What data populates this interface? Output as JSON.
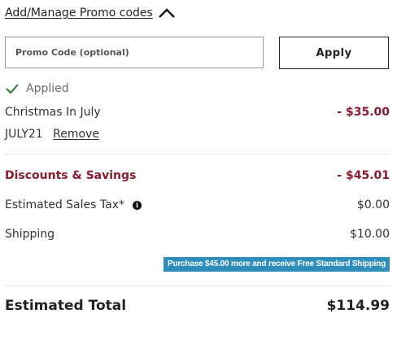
{
  "promo": {
    "toggle_label": "Add/Manage Promo codes",
    "input_placeholder": "Promo Code (optional)",
    "input_value": "",
    "apply_label": "Apply",
    "applied_label": "Applied",
    "applied_promo_name": "Christmas In July",
    "applied_promo_amount": "- $35.00",
    "applied_code": "JULY21",
    "remove_label": "Remove"
  },
  "summary": {
    "discounts_label": "Discounts & Savings",
    "discounts_value": "- $45.01",
    "tax_label": "Estimated Sales Tax*",
    "tax_value": "$0.00",
    "shipping_label": "Shipping",
    "shipping_value": "$10.00",
    "shipping_banner": "Purchase $45.00 more and receive Free Standard Shipping",
    "total_label": "Estimated Total",
    "total_value": "$114.99"
  },
  "colors": {
    "accent_red": "#8b1a2e",
    "banner_blue": "#2e8fbc",
    "check_green": "#2e7d32"
  },
  "icons": {
    "toggle": "chevron-up-icon",
    "applied": "check-icon",
    "tax_info": "info-icon"
  }
}
